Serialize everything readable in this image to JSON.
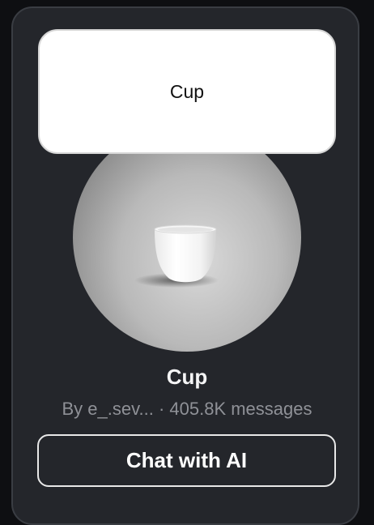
{
  "bubble": {
    "text": "Cup"
  },
  "character": {
    "name": "Cup",
    "author": "By e_.sev...",
    "separator": "·",
    "messages": "405.8K messages"
  },
  "cta": {
    "label": "Chat with AI"
  },
  "colors": {
    "card_bg": "#24262b",
    "card_border": "#3a3d43",
    "bubble_bg": "#ffffff",
    "meta_text": "#8f9197",
    "title_text": "#f4f4f5"
  },
  "icons": {
    "avatar": "cup-image"
  }
}
